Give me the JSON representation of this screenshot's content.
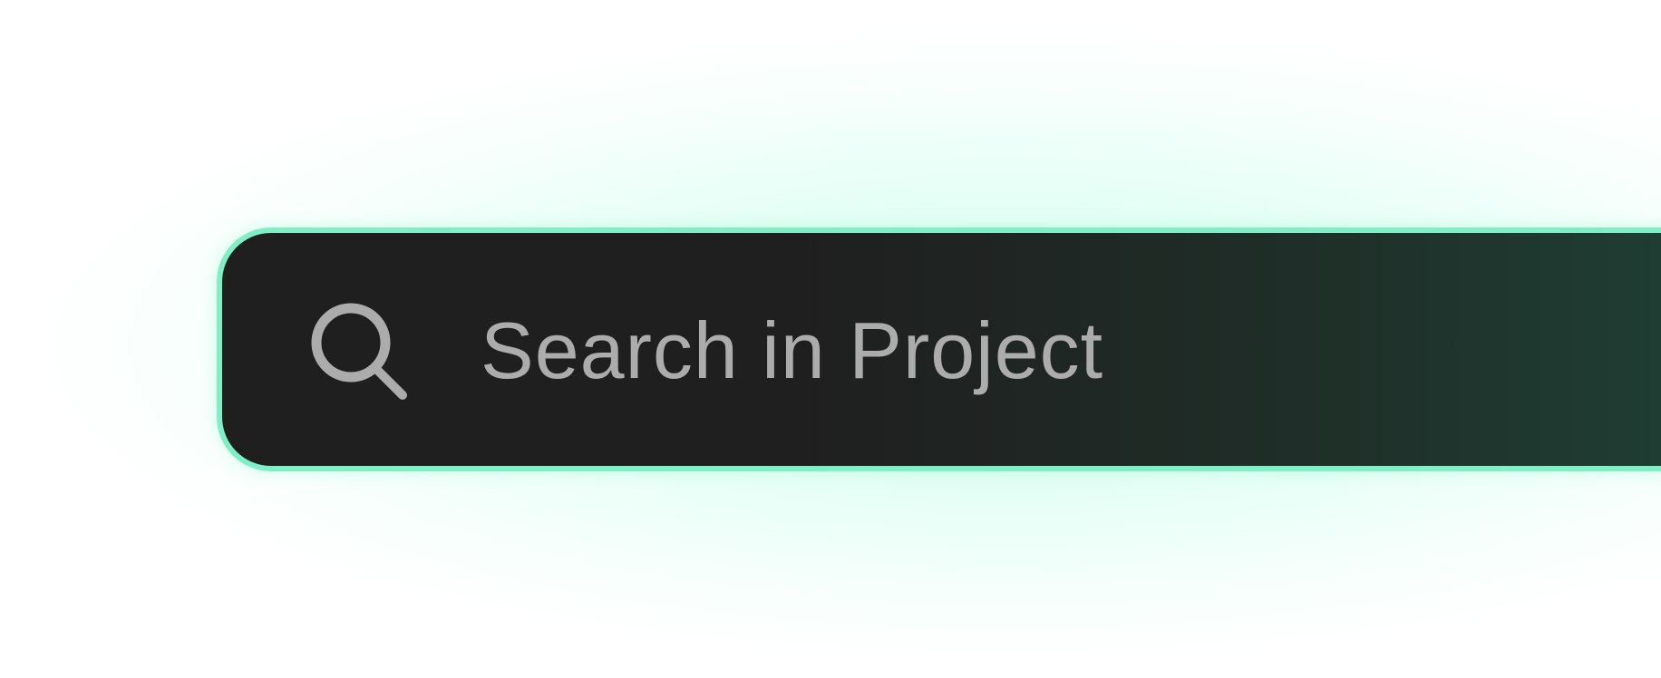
{
  "search": {
    "placeholder": "Search in Project",
    "icon": "search-icon"
  },
  "colors": {
    "background": "#ffffff",
    "bar_dark": "#1f1f1f",
    "bar_green": "#1f4136",
    "border_accent": "#7ff0c6",
    "placeholder_text": "#acacac",
    "icon": "#acacac"
  }
}
